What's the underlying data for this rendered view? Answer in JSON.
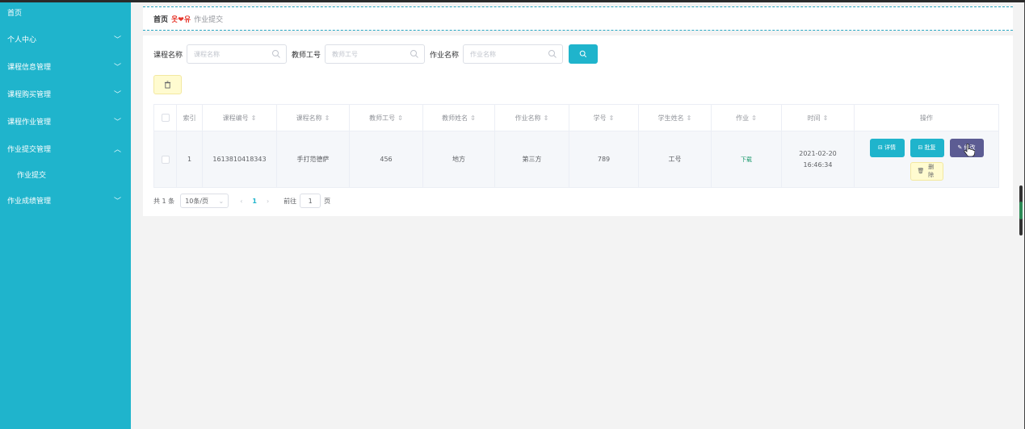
{
  "colors": {
    "sidebar": "#1fb4cc",
    "accent": "#1fb4cc",
    "edit": "#5c5c93",
    "delete_bg": "#fffbd0",
    "breadcrumb_sep": "#e6362b",
    "download_link": "#1a9a6c"
  },
  "sidebar": {
    "home": "首页",
    "menus": [
      {
        "label": "个人中心",
        "expanded": false
      },
      {
        "label": "课程信息管理",
        "expanded": false
      },
      {
        "label": "课程购买管理",
        "expanded": false
      },
      {
        "label": "课程作业管理",
        "expanded": false
      },
      {
        "label": "作业提交管理",
        "expanded": true,
        "children": [
          "作业提交"
        ]
      },
      {
        "label": "作业成绩管理",
        "expanded": false
      }
    ]
  },
  "breadcrumb": {
    "home": "首页",
    "separator": "옷❤유",
    "current": "作业提交"
  },
  "search": {
    "fields": [
      {
        "label": "课程名称",
        "placeholder": "课程名称",
        "value": ""
      },
      {
        "label": "教师工号",
        "placeholder": "教师工号",
        "value": ""
      },
      {
        "label": "作业名称",
        "placeholder": "作业名称",
        "value": ""
      }
    ],
    "button_icon": "search-icon"
  },
  "toolbar": {
    "batch_delete_icon": "trash-icon"
  },
  "table": {
    "columns": [
      "索引",
      "课程编号",
      "课程名称",
      "教师工号",
      "教师姓名",
      "作业名称",
      "学号",
      "学生姓名",
      "作业",
      "时间",
      "操作"
    ],
    "sortable": [
      false,
      true,
      true,
      true,
      true,
      true,
      true,
      true,
      true,
      true,
      false
    ],
    "rows": [
      {
        "index": "1",
        "course_no": "1613810418343",
        "course_name": "手打范德萨",
        "teacher_no": "456",
        "teacher_name": "地方",
        "homework_name": "第三方",
        "student_no": "789",
        "student_name": "工号",
        "homework": "下载",
        "time": "2021-02-20 16:46:34"
      }
    ],
    "actions": {
      "detail": "详情",
      "reply": "批复",
      "edit": "修改",
      "delete": "删除"
    }
  },
  "pagination": {
    "total": "共 1 条",
    "page_size": "10条/页",
    "current_page": "1",
    "goto_prefix": "前往",
    "goto_value": "1",
    "goto_suffix": "页"
  }
}
